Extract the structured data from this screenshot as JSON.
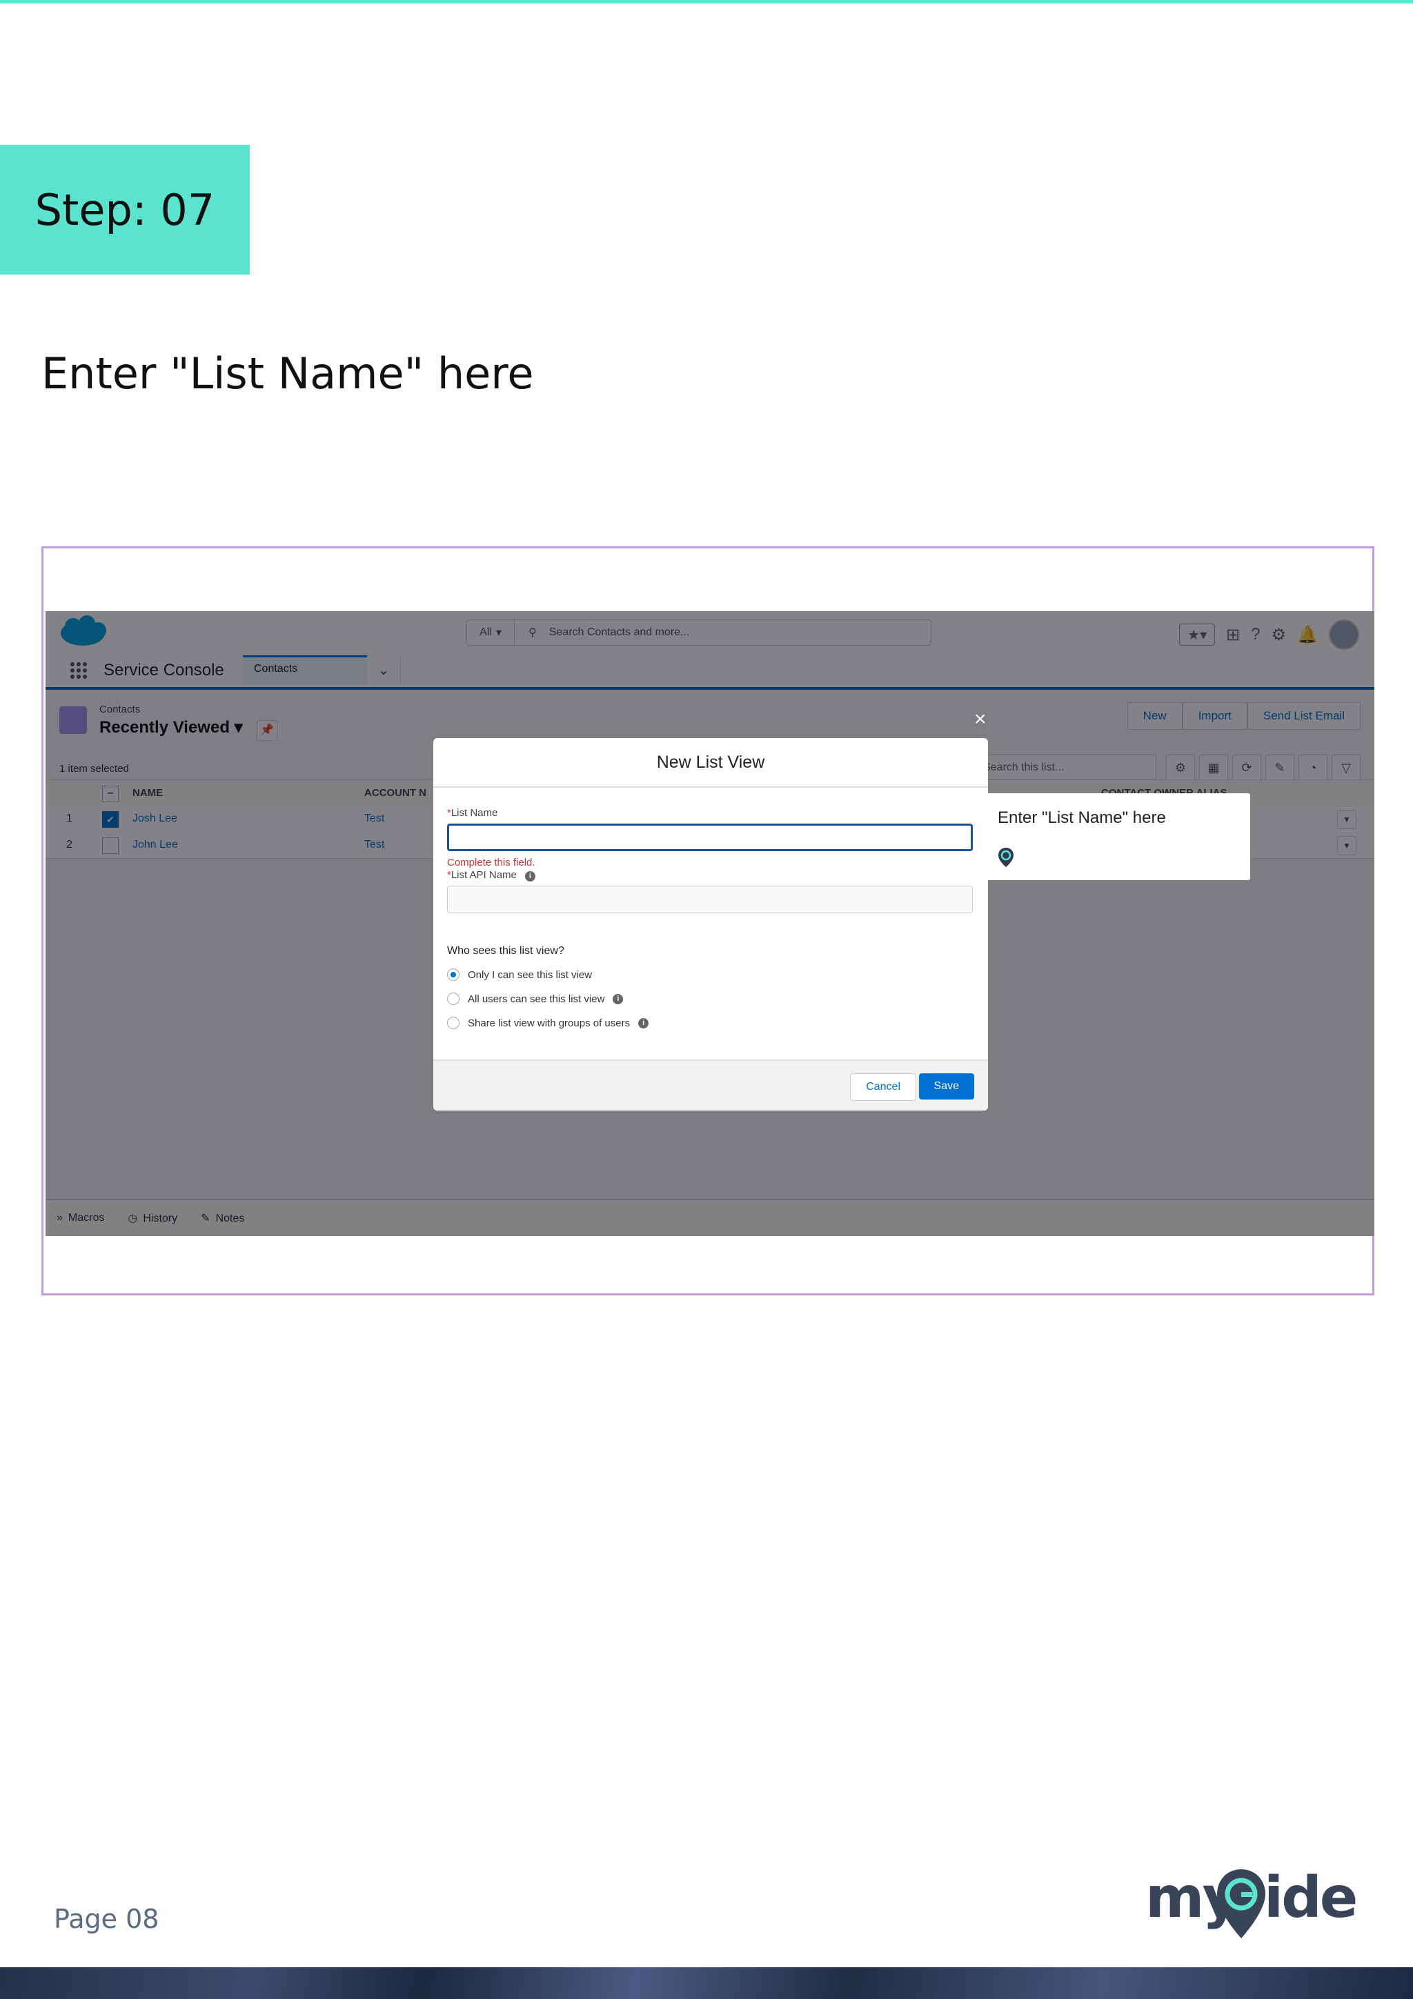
{
  "step": {
    "label": "Step: 07"
  },
  "instruction": "Enter \"List Name\" here",
  "screenshot": {
    "header": {
      "search_scope": "All",
      "search_placeholder": "Search Contacts and more..."
    },
    "nav": {
      "app_name": "Service Console",
      "tab_label": "Contacts"
    },
    "list": {
      "object_label": "Contacts",
      "view_name": "Recently Viewed",
      "selected_info": "1 item selected",
      "actions": [
        "New",
        "Import",
        "Send List Email"
      ],
      "search_placeholder": "Search this list...",
      "columns": {
        "name": "NAME",
        "account": "ACCOUNT N",
        "owner": "CONTACT OWNER ALIAS"
      },
      "rows": [
        {
          "num": "1",
          "name": "Josh Lee",
          "account": "Test",
          "checked": true
        },
        {
          "num": "2",
          "name": "John Lee",
          "account": "Test",
          "checked": false
        }
      ]
    },
    "utility_bar": {
      "macros": "Macros",
      "history": "History",
      "notes": "Notes"
    },
    "modal": {
      "title": "New List View",
      "list_name_label": "List Name",
      "list_name_value": "",
      "error_text": "Complete this field.",
      "api_name_label": "List API Name",
      "api_name_value": "",
      "who_sees_label": "Who sees this list view?",
      "options": [
        "Only I can see this list view",
        "All users can see this list view",
        "Share list view with groups of users"
      ],
      "selected_option": 0,
      "cancel_label": "Cancel",
      "save_label": "Save",
      "close_glyph": "×"
    },
    "tooltip": {
      "text": "Enter \"List Name\" here"
    }
  },
  "footer": {
    "page_label": "Page 08",
    "logo": {
      "my": "my",
      "ide": "ide"
    }
  },
  "colors": {
    "accent": "#5be3cf",
    "frame_border": "#c39ed6",
    "salesforce_blue": "#0070d2",
    "save_button": "#0070d2",
    "error": "#c23934"
  }
}
